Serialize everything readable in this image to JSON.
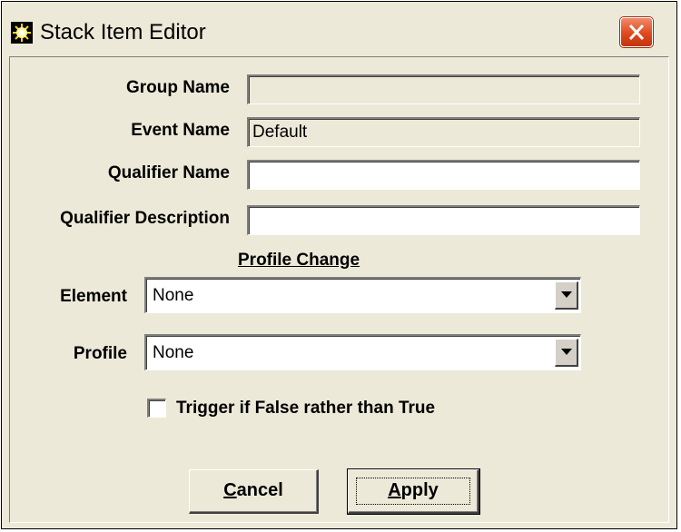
{
  "window": {
    "title": "Stack Item Editor"
  },
  "fields": {
    "group_name": {
      "label": "Group Name",
      "value": ""
    },
    "event_name": {
      "label": "Event Name",
      "value": "Default"
    },
    "qualifier_name": {
      "label": "Qualifier Name",
      "value": ""
    },
    "qualifier_description": {
      "label": "Qualifier Description",
      "value": ""
    }
  },
  "profile_change": {
    "title": "Profile Change",
    "element": {
      "label": "Element",
      "value": "None"
    },
    "profile": {
      "label": "Profile",
      "value": "None"
    }
  },
  "trigger": {
    "label": "Trigger if False rather than True",
    "checked": false
  },
  "buttons": {
    "cancel_first": "C",
    "cancel_rest": "ancel",
    "apply_first": "A",
    "apply_rest": "pply"
  },
  "icons": {
    "app": "starburst-icon",
    "close": "close-icon",
    "dropdown": "chevron-down-icon"
  },
  "colors": {
    "window_bg": "#ece9d8",
    "close_red": "#e0491e",
    "icon_yellow": "#ffd800"
  }
}
